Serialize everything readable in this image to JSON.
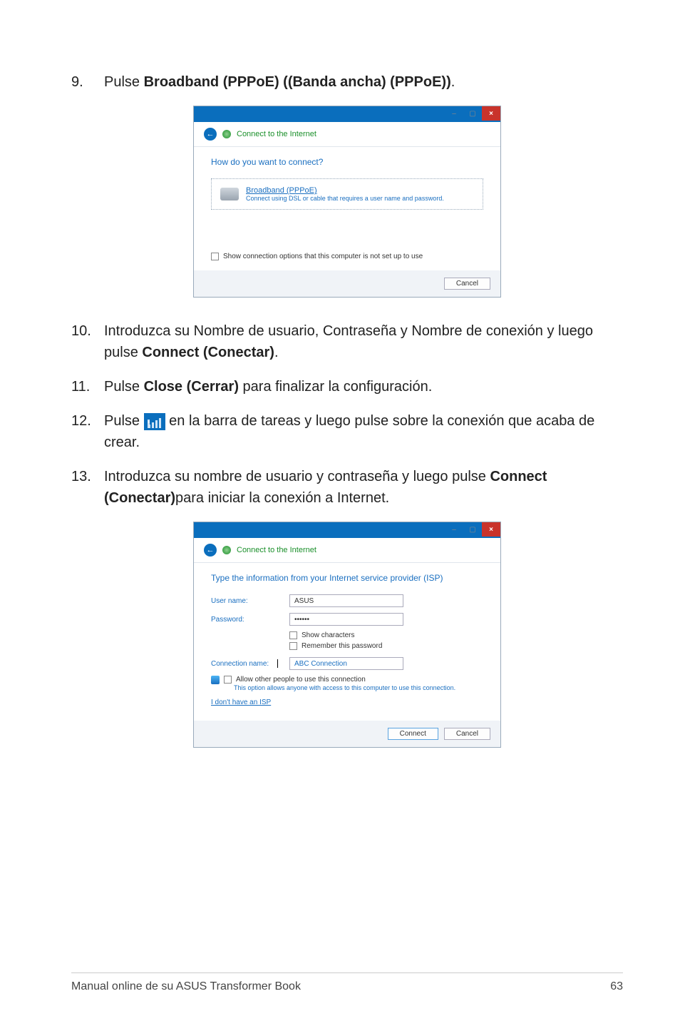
{
  "steps": {
    "s9": {
      "num": "9.",
      "prefix": "Pulse ",
      "bold": "Broadband (PPPoE) ((Banda ancha) (PPPoE))",
      "suffix": "."
    },
    "s10": {
      "num": "10.",
      "prefix": "Introduzca su Nombre de usuario, Contraseña y Nombre de conexión y luego pulse ",
      "bold": "Connect (Conectar)",
      "suffix": "."
    },
    "s11": {
      "num": "11.",
      "prefix": "Pulse ",
      "bold": "Close (Cerrar)",
      "suffix": " para finalizar la configuración."
    },
    "s12": {
      "num": "12.",
      "prefix": "Pulse ",
      "suffix": " en la barra de tareas y luego pulse sobre la conexión que acaba de crear."
    },
    "s13": {
      "num": "13.",
      "prefix": "Introduzca su nombre de usuario y contraseña y luego pulse ",
      "bold": "Connect (Conectar)",
      "suffix": "para iniciar la conexión a Internet."
    }
  },
  "dialog1": {
    "header": "Connect to the Internet",
    "question": "How do you want to connect?",
    "option_title": "Broadband (PPPoE)",
    "option_sub": "Connect using DSL or cable that requires a user name and password.",
    "show_options": "Show connection options that this computer is not set up to use",
    "cancel": "Cancel"
  },
  "dialog2": {
    "header": "Connect to the Internet",
    "question": "Type the information from your Internet service provider (ISP)",
    "username_label": "User name:",
    "username_value": "ASUS",
    "password_label": "Password:",
    "password_value": "••••••",
    "show_chars": "Show characters",
    "remember": "Remember this password",
    "conn_label": "Connection name:",
    "conn_value": "ABC Connection",
    "allow_label": "Allow other people to use this connection",
    "allow_sub": "This option allows anyone with access to this computer to use this connection.",
    "no_isp": "I don't have an ISP",
    "connect": "Connect",
    "cancel": "Cancel"
  },
  "footer": {
    "left": "Manual online de su ASUS Transformer Book",
    "right": "63"
  }
}
